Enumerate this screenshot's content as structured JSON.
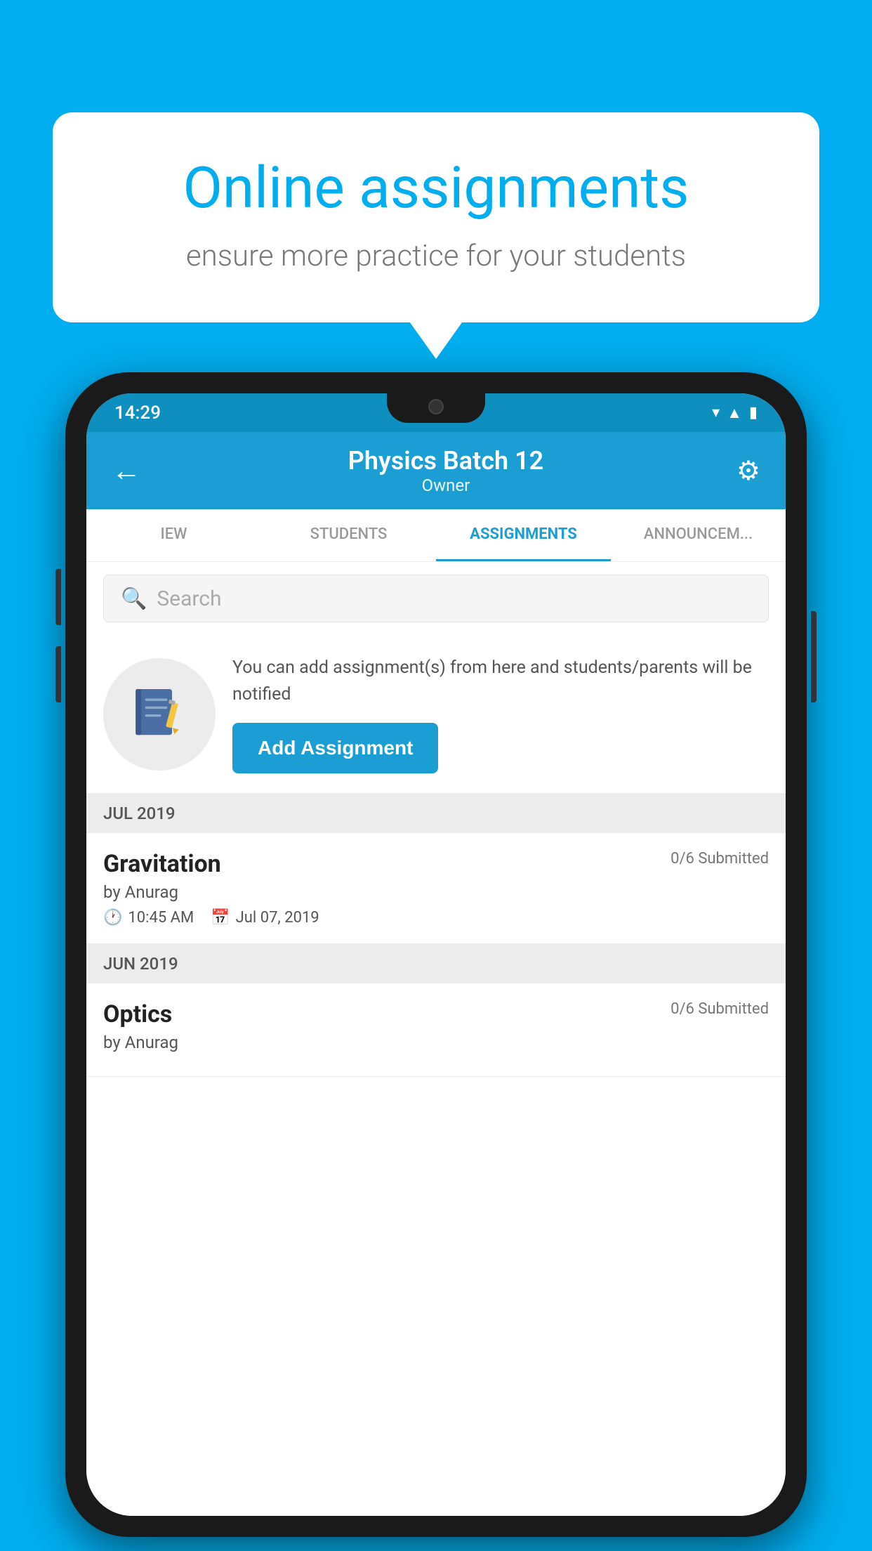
{
  "background_color": "#00AEEF",
  "bubble": {
    "title": "Online assignments",
    "subtitle": "ensure more practice for your students"
  },
  "phone": {
    "status_bar": {
      "time": "14:29",
      "icons": [
        "wifi",
        "signal",
        "battery"
      ]
    },
    "header": {
      "back_label": "←",
      "title": "Physics Batch 12",
      "subtitle": "Owner",
      "settings_label": "⚙"
    },
    "tabs": [
      {
        "label": "IEW",
        "active": false
      },
      {
        "label": "STUDENTS",
        "active": false
      },
      {
        "label": "ASSIGNMENTS",
        "active": true
      },
      {
        "label": "ANNOUNCEM...",
        "active": false
      }
    ],
    "search": {
      "placeholder": "Search"
    },
    "add_assignment": {
      "description": "You can add assignment(s) from here and students/parents will be notified",
      "button_label": "Add Assignment"
    },
    "sections": [
      {
        "month": "JUL 2019",
        "assignments": [
          {
            "title": "Gravitation",
            "submitted": "0/6 Submitted",
            "by": "by Anurag",
            "time": "10:45 AM",
            "date": "Jul 07, 2019"
          }
        ]
      },
      {
        "month": "JUN 2019",
        "assignments": [
          {
            "title": "Optics",
            "submitted": "0/6 Submitted",
            "by": "by Anurag",
            "time": "",
            "date": ""
          }
        ]
      }
    ]
  }
}
